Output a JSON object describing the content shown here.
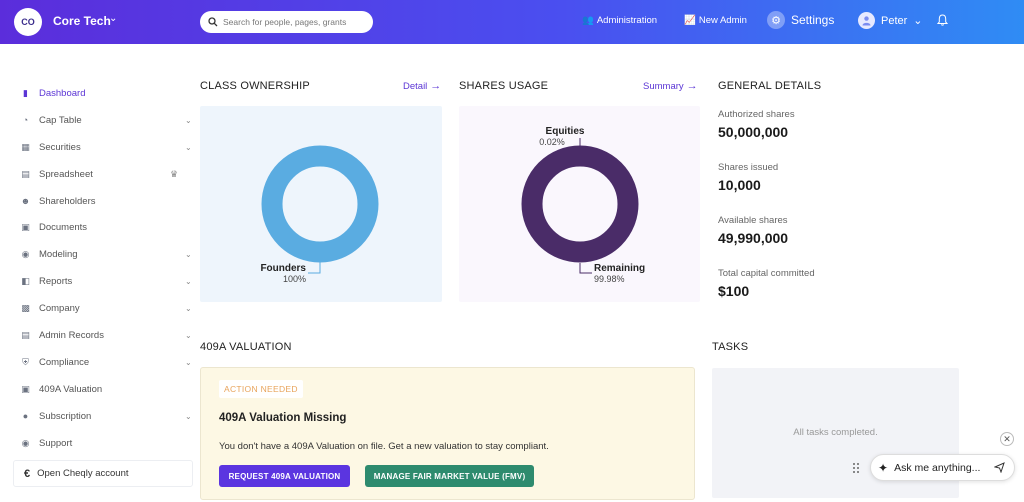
{
  "topbar": {
    "org_initials": "CO",
    "org_name": "Core Tech",
    "search_placeholder": "Search for people, pages, grants",
    "admin_label": "Administration",
    "new_admin_label": "New Admin",
    "settings_label": "Settings",
    "user_name": "Peter"
  },
  "sidebar": {
    "items": [
      {
        "label": "Dashboard",
        "icon": "dashboard-icon"
      },
      {
        "label": "Cap Table",
        "icon": "pie-icon"
      },
      {
        "label": "Securities",
        "icon": "document-icon"
      },
      {
        "label": "Spreadsheet",
        "icon": "table-icon"
      },
      {
        "label": "Shareholders",
        "icon": "user-icon"
      },
      {
        "label": "Documents",
        "icon": "folder-icon"
      },
      {
        "label": "Modeling",
        "icon": "bulb-icon"
      },
      {
        "label": "Reports",
        "icon": "chart-icon"
      },
      {
        "label": "Company",
        "icon": "building-icon"
      },
      {
        "label": "Admin Records",
        "icon": "records-icon"
      },
      {
        "label": "Compliance",
        "icon": "shield-icon"
      },
      {
        "label": "409A Valuation",
        "icon": "bar-chart-icon"
      },
      {
        "label": "Subscription",
        "icon": "dollar-icon"
      },
      {
        "label": "Support",
        "icon": "chat-icon"
      }
    ],
    "cheqly_label": "Open Cheqly account"
  },
  "class_ownership": {
    "title": "CLASS OWNERSHIP",
    "link": "Detail",
    "chart_data": {
      "type": "pie",
      "labels": [
        "Founders"
      ],
      "values": [
        100
      ],
      "value_labels": [
        "100%"
      ],
      "colors": [
        "#5aace1"
      ]
    }
  },
  "shares_usage": {
    "title": "SHARES USAGE",
    "link": "Summary",
    "chart_data": {
      "type": "pie",
      "labels": [
        "Equities",
        "Remaining"
      ],
      "values": [
        0.02,
        99.98
      ],
      "value_labels": [
        "0.02%",
        "99.98%"
      ],
      "colors": [
        "#4a2c68",
        "#4a2c68"
      ]
    }
  },
  "general_details": {
    "title": "GENERAL DETAILS",
    "items": [
      {
        "label": "Authorized shares",
        "value": "50,000,000"
      },
      {
        "label": "Shares issued",
        "value": "10,000"
      },
      {
        "label": "Available shares",
        "value": "49,990,000"
      },
      {
        "label": "Total capital committed",
        "value": "$100"
      }
    ]
  },
  "valuation": {
    "title": "409A VALUATION",
    "badge": "ACTION NEEDED",
    "heading": "409A Valuation Missing",
    "description": "You don't have a 409A Valuation on file. Get a new valuation to stay compliant.",
    "request_button": "REQUEST 409A VALUATION",
    "fmv_button": "MANAGE FAIR MARKET VALUE (FMV)"
  },
  "tasks": {
    "title": "TASKS",
    "empty_message": "All tasks completed."
  },
  "assistant": {
    "placeholder": "Ask me anything..."
  },
  "colors": {
    "accent": "#5b35d5",
    "founders": "#5aace1",
    "shares": "#4a2c68",
    "fmv_button": "#2e8b6e"
  }
}
